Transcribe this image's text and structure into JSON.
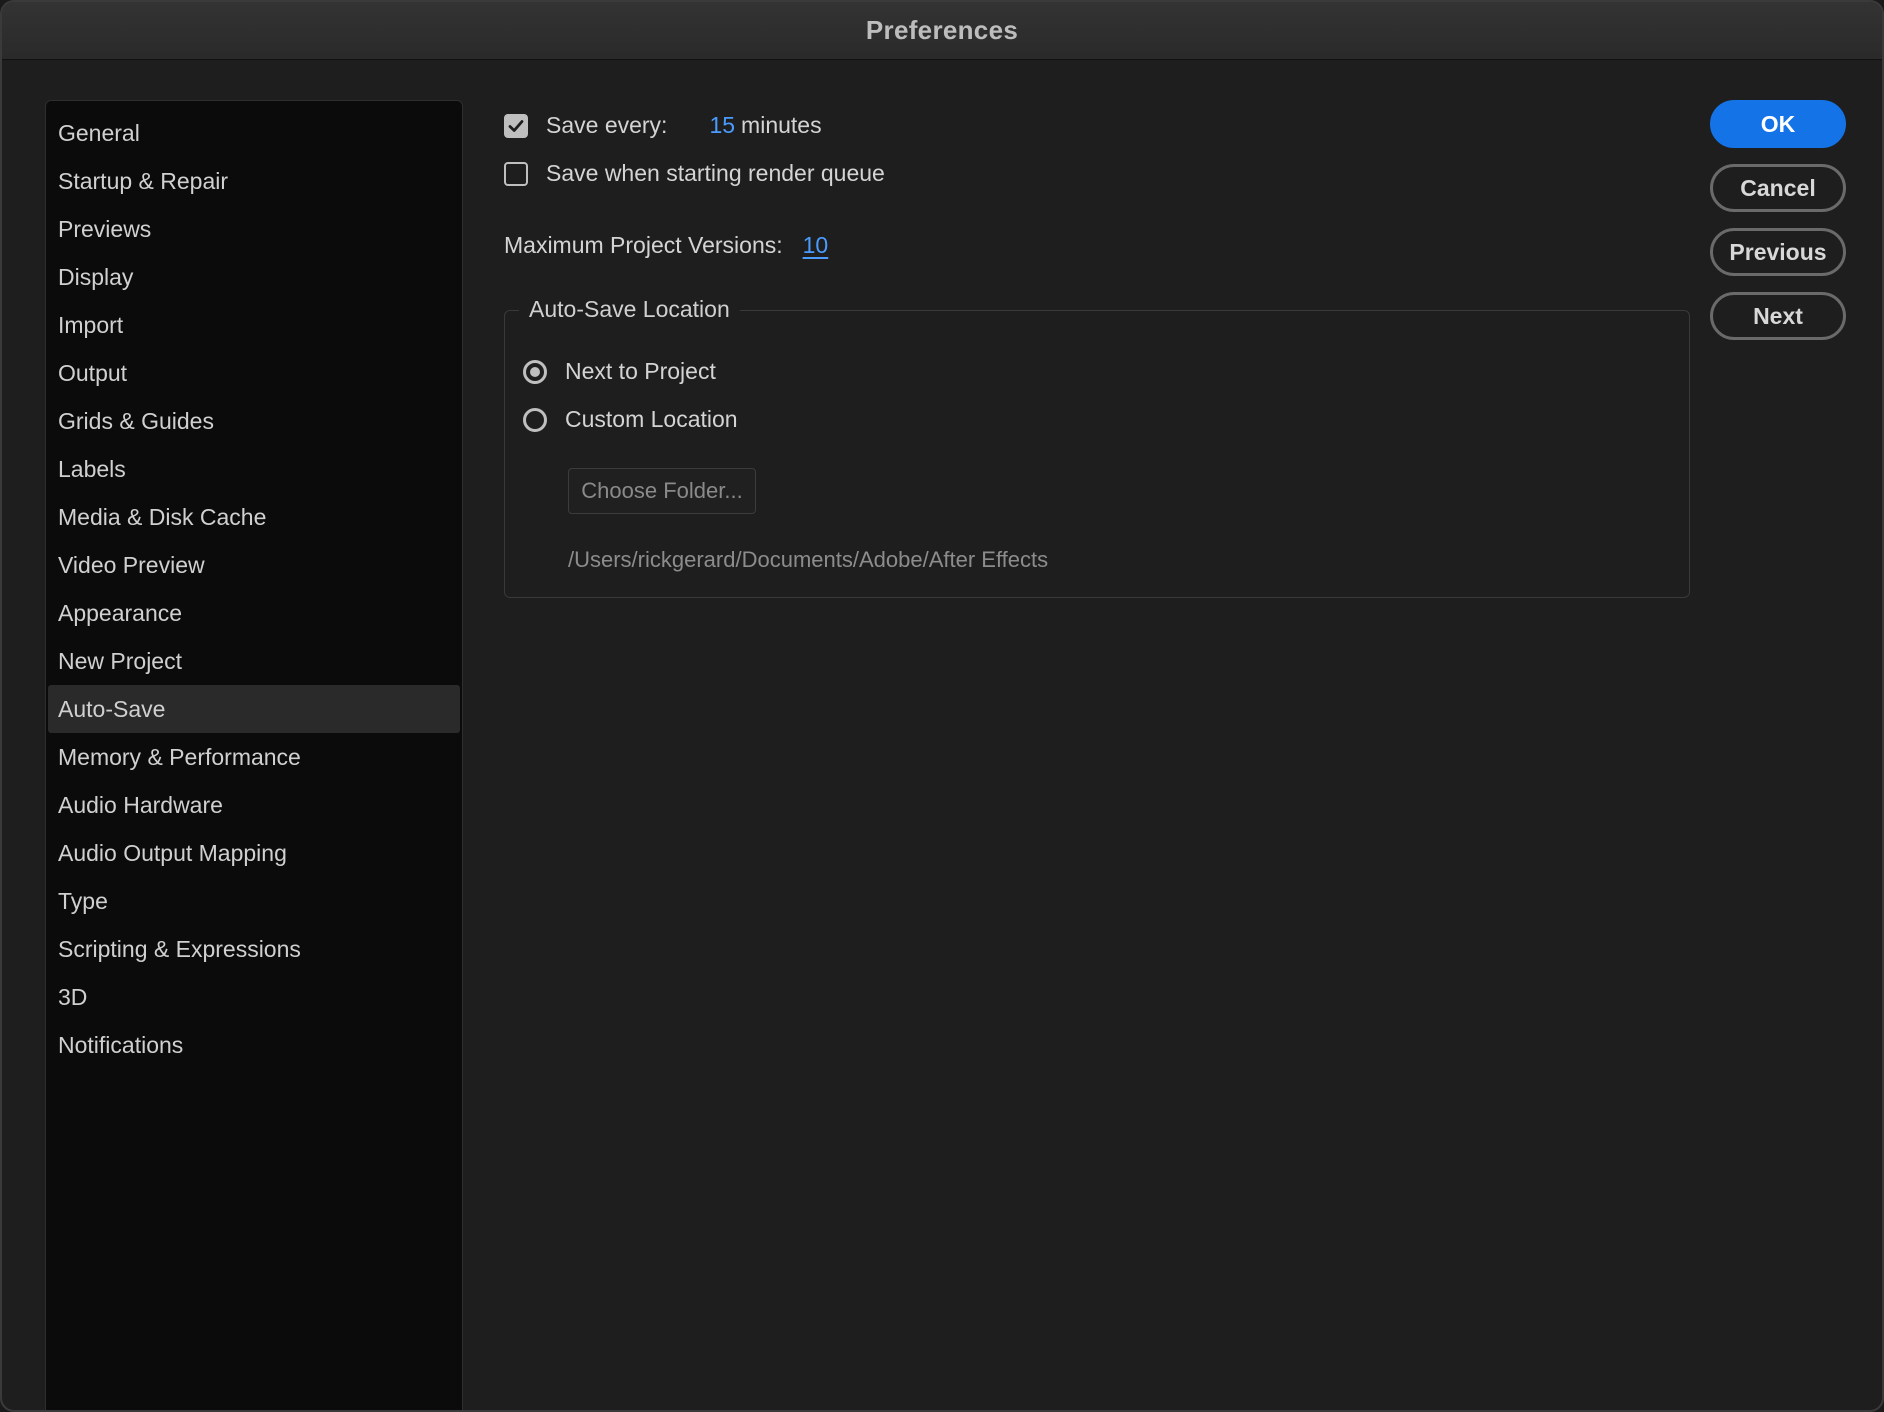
{
  "window": {
    "title": "Preferences"
  },
  "sidebar": {
    "items": [
      {
        "label": "General"
      },
      {
        "label": "Startup & Repair"
      },
      {
        "label": "Previews"
      },
      {
        "label": "Display"
      },
      {
        "label": "Import"
      },
      {
        "label": "Output"
      },
      {
        "label": "Grids & Guides"
      },
      {
        "label": "Labels"
      },
      {
        "label": "Media & Disk Cache"
      },
      {
        "label": "Video Preview"
      },
      {
        "label": "Appearance"
      },
      {
        "label": "New Project"
      },
      {
        "label": "Auto-Save",
        "active": true
      },
      {
        "label": "Memory & Performance"
      },
      {
        "label": "Audio Hardware"
      },
      {
        "label": "Audio Output Mapping"
      },
      {
        "label": "Type"
      },
      {
        "label": "Scripting & Expressions"
      },
      {
        "label": "3D"
      },
      {
        "label": "Notifications"
      }
    ]
  },
  "autosave": {
    "save_every": {
      "label": "Save every:",
      "value": "15",
      "unit": "minutes",
      "checked": true
    },
    "render_queue": {
      "label": "Save when starting render queue",
      "checked": false
    },
    "max_versions": {
      "label": "Maximum Project Versions:",
      "value": "10"
    },
    "location": {
      "legend": "Auto-Save Location",
      "options": [
        {
          "label": "Next to Project",
          "selected": true
        },
        {
          "label": "Custom Location",
          "selected": false
        }
      ],
      "choose_folder_label": "Choose Folder...",
      "path": "/Users/rickgerard/Documents/Adobe/After Effects"
    }
  },
  "buttons": {
    "ok": "OK",
    "cancel": "Cancel",
    "previous": "Previous",
    "next": "Next"
  },
  "colors": {
    "accent": "#1473e6",
    "link": "#4b9bff"
  }
}
